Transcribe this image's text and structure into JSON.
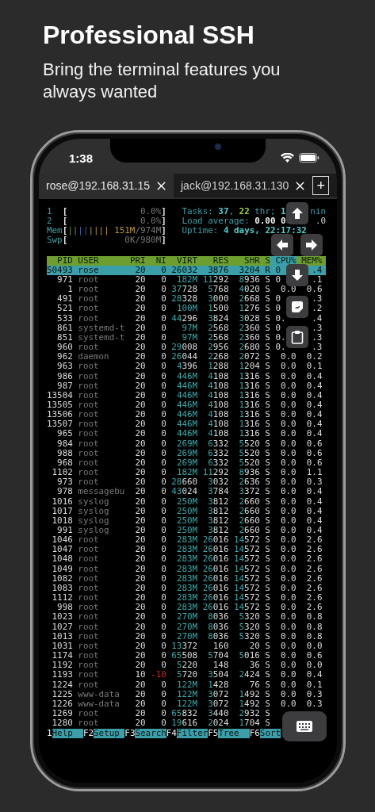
{
  "headline": "Professional SSH",
  "subline": "Bring the terminal features you always wanted",
  "status_bar": {
    "time": "1:38"
  },
  "tabs": [
    {
      "label": "rose@192.168.31.15",
      "selected": true
    },
    {
      "label": "jack@192.168.31.130",
      "selected": false
    }
  ],
  "new_tab": "+",
  "meters": [
    {
      "label": "1",
      "open": "[",
      "value": [
        {
          "text": "0.0%",
          "kind": "dim"
        }
      ],
      "close": "]"
    },
    {
      "label": "2",
      "open": "[",
      "value": [
        {
          "text": "0.0%",
          "kind": "dim"
        }
      ],
      "close": "]"
    },
    {
      "label": "Mem",
      "open": "[",
      "bars": [
        {
          "text": "||",
          "color": "#6a9a2a"
        },
        {
          "text": "||",
          "color": "#3a5fa8"
        },
        {
          "text": "||||",
          "color": "#b8962a"
        }
      ],
      "value": [
        {
          "text": "151M",
          "kind": "memory"
        },
        {
          "text": "/974M",
          "kind": "dim"
        }
      ],
      "close": "]"
    },
    {
      "label": "Swp",
      "open": "[",
      "value": [
        {
          "text": "0K/980M",
          "kind": "dim"
        }
      ],
      "close": "]"
    }
  ],
  "info": [
    {
      "left": [
        {
          "text": "Tasks: ",
          "kind": "label"
        },
        {
          "text": "37",
          "kind": "count"
        },
        {
          "text": ", ",
          "kind": "label"
        },
        {
          "text": "22",
          "kind": "threads"
        },
        {
          "text": " thr; ",
          "kind": "label"
        },
        {
          "text": "1",
          "kind": "count"
        }
      ],
      "right": [
        {
          "text": "nin",
          "kind": "label"
        }
      ]
    },
    {
      "left": [
        {
          "text": "Load average: ",
          "kind": "label"
        },
        {
          "text": "0.00",
          "kind": "load"
        },
        {
          "text": " 0",
          "kind": "load"
        }
      ],
      "right": [
        {
          "text": ".0",
          "kind": "plain"
        }
      ]
    },
    {
      "left": [
        {
          "text": "Uptime: ",
          "kind": "label"
        },
        {
          "text": "4 days, 22:17:32",
          "kind": "count"
        }
      ]
    }
  ],
  "table": {
    "columns": [
      {
        "label": "PID",
        "sorted": false
      },
      {
        "label": "USER",
        "sorted": false
      },
      {
        "label": "PRI",
        "sorted": false
      },
      {
        "label": "NI",
        "sorted": false
      },
      {
        "label": "VIRT",
        "sorted": false
      },
      {
        "label": "RES",
        "sorted": false
      },
      {
        "label": "SHR",
        "sorted": false
      },
      {
        "label": "S",
        "sorted": false
      },
      {
        "label": "CPU%",
        "sorted": true
      },
      {
        "label": "MEM%",
        "sorted": false
      }
    ],
    "rows": [
      {
        "pid": "50493",
        "user": "rose",
        "pri": "20",
        "ni": "0",
        "virt": "26032",
        "res": "3876",
        "shr": "3204",
        "s": "R",
        "cpu": "0",
        "mem": ".4",
        "selected": true
      },
      {
        "pid": "971",
        "user": "root",
        "pri": "20",
        "ni": "0",
        "virt": "182M",
        "res": "11292",
        "shr": "8936",
        "s": "S",
        "cpu": "0",
        "mem": ".1",
        "selected": false
      },
      {
        "pid": "1",
        "user": "root",
        "pri": "20",
        "ni": "0",
        "virt": "37728",
        "res": "5768",
        "shr": "4020",
        "s": "S",
        "cpu": "0.0",
        "mem": "0.6",
        "selected": false
      },
      {
        "pid": "491",
        "user": "root",
        "pri": "20",
        "ni": "0",
        "virt": "28328",
        "res": "3000",
        "shr": "2668",
        "s": "S",
        "cpu": "0",
        "mem": ".3",
        "selected": false
      },
      {
        "pid": "521",
        "user": "root",
        "pri": "20",
        "ni": "0",
        "virt": "100M",
        "res": "1500",
        "shr": "1276",
        "s": "S",
        "cpu": "0",
        "mem": ".2",
        "selected": false
      },
      {
        "pid": "533",
        "user": "root",
        "pri": "20",
        "ni": "0",
        "virt": "44296",
        "res": "3824",
        "shr": "3028",
        "s": "S",
        "cpu": "0.",
        "mem": ".4",
        "selected": false
      },
      {
        "pid": "861",
        "user": "systemd-t",
        "pri": "20",
        "ni": "0",
        "virt": "97M",
        "res": "2568",
        "shr": "2360",
        "s": "S",
        "cpu": "0",
        "mem": ".3",
        "selected": false
      },
      {
        "pid": "851",
        "user": "systemd-t",
        "pri": "20",
        "ni": "0",
        "virt": "97M",
        "res": "2568",
        "shr": "2360",
        "s": "S",
        "cpu": "0.",
        "mem": ".3",
        "selected": false
      },
      {
        "pid": "960",
        "user": "root",
        "pri": "20",
        "ni": "0",
        "virt": "29008",
        "res": "2956",
        "shr": "2680",
        "s": "S",
        "cpu": "0.",
        "mem": ".3",
        "selected": false
      },
      {
        "pid": "962",
        "user": "daemon",
        "pri": "20",
        "ni": "0",
        "virt": "26044",
        "res": "2268",
        "shr": "2072",
        "s": "S",
        "cpu": "0.0",
        "mem": "0.2",
        "selected": false
      },
      {
        "pid": "963",
        "user": "root",
        "pri": "20",
        "ni": "0",
        "virt": "4396",
        "res": "1288",
        "shr": "1204",
        "s": "S",
        "cpu": "0.0",
        "mem": "0.1",
        "selected": false
      },
      {
        "pid": "986",
        "user": "root",
        "pri": "20",
        "ni": "0",
        "virt": "446M",
        "res": "4108",
        "shr": "1316",
        "s": "S",
        "cpu": "0.0",
        "mem": "0.4",
        "selected": false
      },
      {
        "pid": "987",
        "user": "root",
        "pri": "20",
        "ni": "0",
        "virt": "446M",
        "res": "4108",
        "shr": "1316",
        "s": "S",
        "cpu": "0.0",
        "mem": "0.4",
        "selected": false
      },
      {
        "pid": "13504",
        "user": "root",
        "pri": "20",
        "ni": "0",
        "virt": "446M",
        "res": "4108",
        "shr": "1316",
        "s": "S",
        "cpu": "0.0",
        "mem": "0.4",
        "selected": false
      },
      {
        "pid": "13505",
        "user": "root",
        "pri": "20",
        "ni": "0",
        "virt": "446M",
        "res": "4108",
        "shr": "1316",
        "s": "S",
        "cpu": "0.0",
        "mem": "0.4",
        "selected": false
      },
      {
        "pid": "13506",
        "user": "root",
        "pri": "20",
        "ni": "0",
        "virt": "446M",
        "res": "4108",
        "shr": "1316",
        "s": "S",
        "cpu": "0.0",
        "mem": "0.4",
        "selected": false
      },
      {
        "pid": "13507",
        "user": "root",
        "pri": "20",
        "ni": "0",
        "virt": "446M",
        "res": "4108",
        "shr": "1316",
        "s": "S",
        "cpu": "0.0",
        "mem": "0.4",
        "selected": false
      },
      {
        "pid": "965",
        "user": "root",
        "pri": "20",
        "ni": "0",
        "virt": "446M",
        "res": "4108",
        "shr": "1316",
        "s": "S",
        "cpu": "0.0",
        "mem": "0.4",
        "selected": false
      },
      {
        "pid": "984",
        "user": "root",
        "pri": "20",
        "ni": "0",
        "virt": "269M",
        "res": "6332",
        "shr": "5520",
        "s": "S",
        "cpu": "0.0",
        "mem": "0.6",
        "selected": false
      },
      {
        "pid": "988",
        "user": "root",
        "pri": "20",
        "ni": "0",
        "virt": "269M",
        "res": "6332",
        "shr": "5520",
        "s": "S",
        "cpu": "0.0",
        "mem": "0.6",
        "selected": false
      },
      {
        "pid": "968",
        "user": "root",
        "pri": "20",
        "ni": "0",
        "virt": "269M",
        "res": "6332",
        "shr": "5520",
        "s": "S",
        "cpu": "0.0",
        "mem": "0.6",
        "selected": false
      },
      {
        "pid": "1102",
        "user": "root",
        "pri": "20",
        "ni": "0",
        "virt": "182M",
        "res": "11292",
        "shr": "8936",
        "s": "S",
        "cpu": "0.0",
        "mem": "1.1",
        "selected": false
      },
      {
        "pid": "973",
        "user": "root",
        "pri": "20",
        "ni": "0",
        "virt": "28660",
        "res": "3032",
        "shr": "2636",
        "s": "S",
        "cpu": "0.0",
        "mem": "0.3",
        "selected": false
      },
      {
        "pid": "978",
        "user": "messagebu",
        "pri": "20",
        "ni": "0",
        "virt": "43024",
        "res": "3784",
        "shr": "3372",
        "s": "S",
        "cpu": "0.0",
        "mem": "0.4",
        "selected": false
      },
      {
        "pid": "1016",
        "user": "syslog",
        "pri": "20",
        "ni": "0",
        "virt": "250M",
        "res": "3812",
        "shr": "2660",
        "s": "S",
        "cpu": "0.0",
        "mem": "0.4",
        "selected": false
      },
      {
        "pid": "1017",
        "user": "syslog",
        "pri": "20",
        "ni": "0",
        "virt": "250M",
        "res": "3812",
        "shr": "2660",
        "s": "S",
        "cpu": "0.0",
        "mem": "0.4",
        "selected": false
      },
      {
        "pid": "1018",
        "user": "syslog",
        "pri": "20",
        "ni": "0",
        "virt": "250M",
        "res": "3812",
        "shr": "2660",
        "s": "S",
        "cpu": "0.0",
        "mem": "0.4",
        "selected": false
      },
      {
        "pid": "991",
        "user": "syslog",
        "pri": "20",
        "ni": "0",
        "virt": "250M",
        "res": "3812",
        "shr": "2660",
        "s": "S",
        "cpu": "0.0",
        "mem": "0.4",
        "selected": false
      },
      {
        "pid": "1046",
        "user": "root",
        "pri": "20",
        "ni": "0",
        "virt": "283M",
        "res": "26016",
        "shr": "14572",
        "s": "S",
        "cpu": "0.0",
        "mem": "2.6",
        "selected": false
      },
      {
        "pid": "1047",
        "user": "root",
        "pri": "20",
        "ni": "0",
        "virt": "283M",
        "res": "26016",
        "shr": "14572",
        "s": "S",
        "cpu": "0.0",
        "mem": "2.6",
        "selected": false
      },
      {
        "pid": "1048",
        "user": "root",
        "pri": "20",
        "ni": "0",
        "virt": "283M",
        "res": "26016",
        "shr": "14572",
        "s": "S",
        "cpu": "0.0",
        "mem": "2.6",
        "selected": false
      },
      {
        "pid": "1049",
        "user": "root",
        "pri": "20",
        "ni": "0",
        "virt": "283M",
        "res": "26016",
        "shr": "14572",
        "s": "S",
        "cpu": "0.0",
        "mem": "2.6",
        "selected": false
      },
      {
        "pid": "1082",
        "user": "root",
        "pri": "20",
        "ni": "0",
        "virt": "283M",
        "res": "26016",
        "shr": "14572",
        "s": "S",
        "cpu": "0.0",
        "mem": "2.6",
        "selected": false
      },
      {
        "pid": "1083",
        "user": "root",
        "pri": "20",
        "ni": "0",
        "virt": "283M",
        "res": "26016",
        "shr": "14572",
        "s": "S",
        "cpu": "0.0",
        "mem": "2.6",
        "selected": false
      },
      {
        "pid": "1112",
        "user": "root",
        "pri": "20",
        "ni": "0",
        "virt": "283M",
        "res": "26016",
        "shr": "14572",
        "s": "S",
        "cpu": "0.0",
        "mem": "2.6",
        "selected": false
      },
      {
        "pid": "998",
        "user": "root",
        "pri": "20",
        "ni": "0",
        "virt": "283M",
        "res": "26016",
        "shr": "14572",
        "s": "S",
        "cpu": "0.0",
        "mem": "2.6",
        "selected": false
      },
      {
        "pid": "1023",
        "user": "root",
        "pri": "20",
        "ni": "0",
        "virt": "270M",
        "res": "8036",
        "shr": "5320",
        "s": "S",
        "cpu": "0.0",
        "mem": "0.8",
        "selected": false
      },
      {
        "pid": "1027",
        "user": "root",
        "pri": "20",
        "ni": "0",
        "virt": "270M",
        "res": "8036",
        "shr": "5320",
        "s": "S",
        "cpu": "0.0",
        "mem": "0.8",
        "selected": false
      },
      {
        "pid": "1013",
        "user": "root",
        "pri": "20",
        "ni": "0",
        "virt": "270M",
        "res": "8036",
        "shr": "5320",
        "s": "S",
        "cpu": "0.0",
        "mem": "0.8",
        "selected": false
      },
      {
        "pid": "1031",
        "user": "root",
        "pri": "20",
        "ni": "0",
        "virt": "13372",
        "res": "160",
        "shr": "20",
        "s": "S",
        "cpu": "0.0",
        "mem": "0.0",
        "selected": false
      },
      {
        "pid": "1174",
        "user": "root",
        "pri": "20",
        "ni": "0",
        "virt": "65508",
        "res": "5704",
        "shr": "5016",
        "s": "S",
        "cpu": "0.0",
        "mem": "0.6",
        "selected": false
      },
      {
        "pid": "1192",
        "user": "root",
        "pri": "20",
        "ni": "0",
        "virt": "5220",
        "res": "148",
        "shr": "36",
        "s": "S",
        "cpu": "0.0",
        "mem": "0.0",
        "selected": false
      },
      {
        "pid": "1193",
        "user": "root",
        "pri": "10",
        "ni": "-10",
        "virt": "5720",
        "res": "3504",
        "shr": "2424",
        "s": "S",
        "cpu": "0.0",
        "mem": "0.4",
        "selected": false
      },
      {
        "pid": "1224",
        "user": "root",
        "pri": "20",
        "ni": "0",
        "virt": "122M",
        "res": "1428",
        "shr": "76",
        "s": "S",
        "cpu": "0.0",
        "mem": "0.1",
        "selected": false
      },
      {
        "pid": "1225",
        "user": "www-data",
        "pri": "20",
        "ni": "0",
        "virt": "122M",
        "res": "3072",
        "shr": "1492",
        "s": "S",
        "cpu": "0.0",
        "mem": "0.3",
        "selected": false
      },
      {
        "pid": "1226",
        "user": "www-data",
        "pri": "20",
        "ni": "0",
        "virt": "122M",
        "res": "3072",
        "shr": "1492",
        "s": "S",
        "cpu": "0.0",
        "mem": "0.3",
        "selected": false
      },
      {
        "pid": "1269",
        "user": "root",
        "pri": "20",
        "ni": "0",
        "virt": "65832",
        "res": "3440",
        "shr": "2932",
        "s": "S",
        "selected": false
      },
      {
        "pid": "1280",
        "user": "root",
        "pri": "20",
        "ni": "0",
        "virt": "19616",
        "res": "2024",
        "shr": "1704",
        "s": "S",
        "selected": false
      }
    ]
  },
  "function_keys": [
    {
      "key": "1",
      "label": "Help"
    },
    {
      "key": "F2",
      "label": "Setup"
    },
    {
      "key": "F3",
      "label": "Search"
    },
    {
      "key": "F4",
      "label": "Filter"
    },
    {
      "key": "F5",
      "label": "Tree"
    },
    {
      "key": "F6",
      "label": "Sort"
    }
  ],
  "overlay_buttons": [
    {
      "kind": "up"
    },
    {
      "kind": "left"
    },
    {
      "kind": "right"
    },
    {
      "kind": "down"
    },
    {
      "kind": "sticker"
    },
    {
      "kind": "clipboard"
    },
    {
      "kind": "keyboard"
    }
  ]
}
